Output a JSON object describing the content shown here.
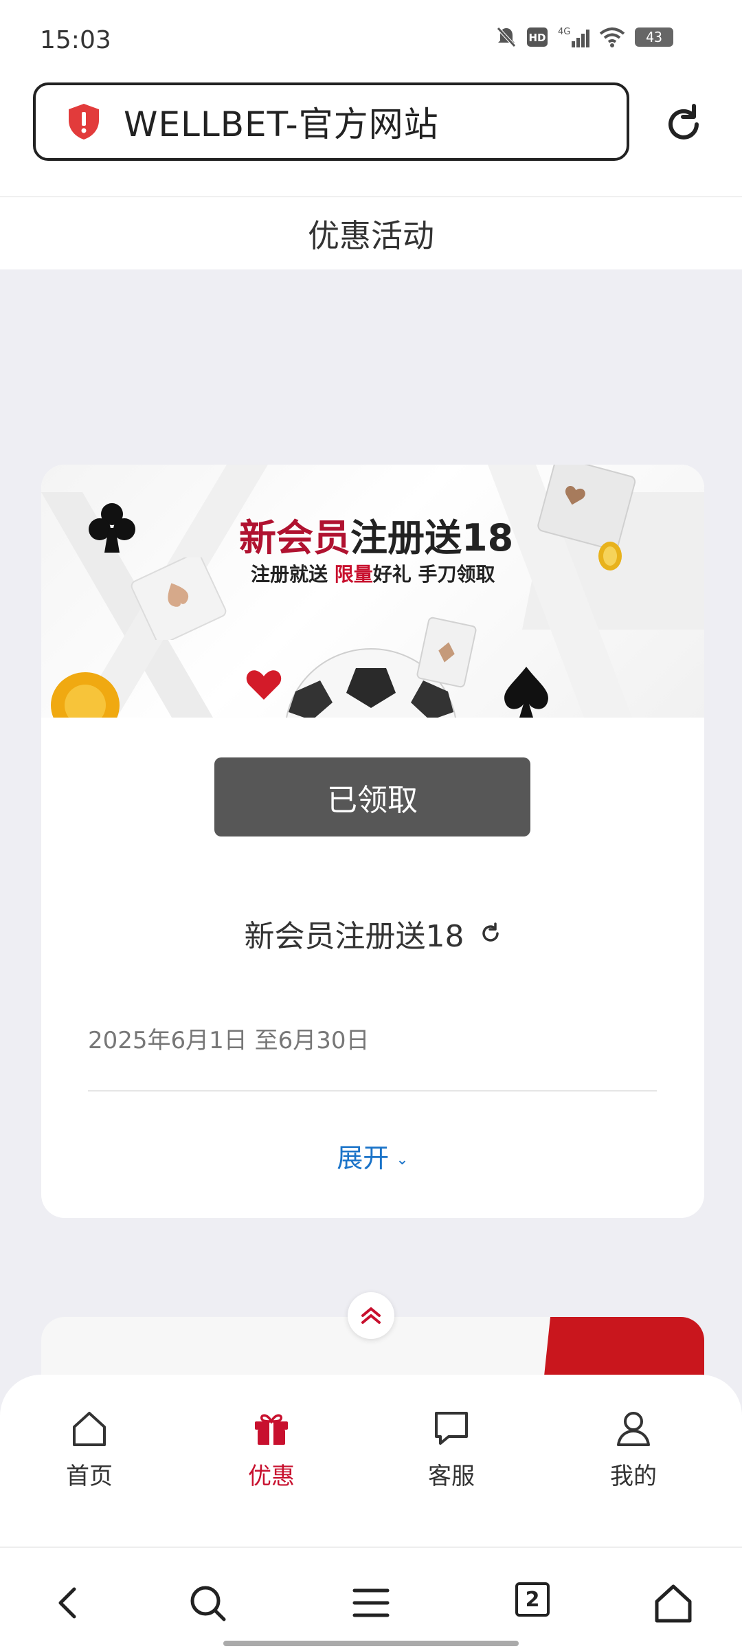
{
  "status_bar": {
    "time": "15:03",
    "battery": "43",
    "icons": [
      "mute-icon",
      "hd-icon",
      "signal-4g-icon",
      "wifi-icon",
      "battery-icon"
    ]
  },
  "address_bar": {
    "url_title": "WELLBET-官方网站",
    "icons": [
      "shield-alert-icon",
      "reload-icon"
    ]
  },
  "page": {
    "title": "优惠活动"
  },
  "promo": {
    "banner_title_red": "新会员",
    "banner_title_black": "注册送18",
    "banner_sub_1": "注册就送",
    "banner_sub_red": "限量",
    "banner_sub_2": "好礼 手刀领取",
    "claim_label": "已领取",
    "name": "新会员注册送18",
    "date_range": "2025年6月1日 至6月30日",
    "expand_label": "展开"
  },
  "tabbar": {
    "items": [
      {
        "label": "首页",
        "icon": "home-icon",
        "active": false
      },
      {
        "label": "优惠",
        "icon": "gift-icon",
        "active": true
      },
      {
        "label": "客服",
        "icon": "chat-icon",
        "active": false
      },
      {
        "label": "我的",
        "icon": "user-icon",
        "active": false
      }
    ]
  },
  "browser_nav": {
    "tab_count": "2",
    "icons": [
      "back-icon",
      "search-icon",
      "menu-icon",
      "tabs-icon",
      "home-icon"
    ]
  },
  "colors": {
    "accent_red": "#c8102e",
    "link_blue": "#1a73c8",
    "claimed_gray": "#575757",
    "page_bg": "#eeeef3"
  }
}
